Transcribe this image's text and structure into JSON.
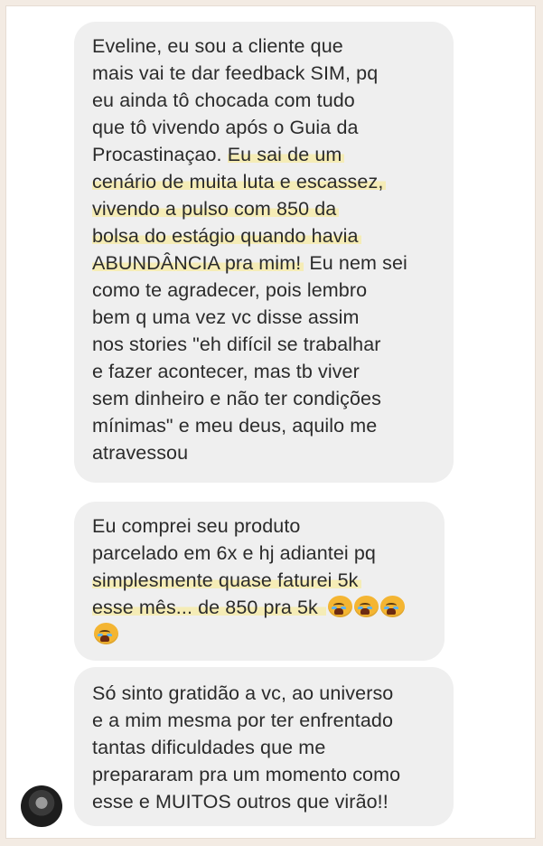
{
  "messages": [
    {
      "lines": [
        [
          {
            "t": "Eveline, eu sou a cliente que"
          }
        ],
        [
          {
            "t": "mais vai te dar feedback SIM, pq"
          }
        ],
        [
          {
            "t": "eu ainda tô chocada com tudo"
          }
        ],
        [
          {
            "t": "que tô vivendo após o Guia da"
          }
        ],
        [
          {
            "t": "Procastinaçao. "
          },
          {
            "t": "Eu sai de um",
            "hl": true
          }
        ],
        [
          {
            "t": "cenário de muita luta e escassez,",
            "hl": true
          }
        ],
        [
          {
            "t": "vivendo a pulso com 850 da",
            "hl": true
          }
        ],
        [
          {
            "t": "bolsa do estágio quando havia",
            "hl": true
          }
        ],
        [
          {
            "t": "ABUNDÂNCIA pra mim!",
            "hl": true
          },
          {
            "t": " Eu nem sei"
          }
        ],
        [
          {
            "t": "como te agradecer, pois lembro"
          }
        ],
        [
          {
            "t": "bem q uma vez vc disse assim"
          }
        ],
        [
          {
            "t": "nos stories \"eh difícil se trabalhar"
          }
        ],
        [
          {
            "t": "e fazer acontecer, mas tb viver"
          }
        ],
        [
          {
            "t": "sem dinheiro e não ter condições"
          }
        ],
        [
          {
            "t": "mínimas\" e meu deus, aquilo me"
          }
        ],
        [
          {
            "t": "atravessou"
          }
        ]
      ]
    },
    {
      "lines": [
        [
          {
            "t": "Eu comprei seu produto"
          }
        ],
        [
          {
            "t": "parcelado em 6x e hj adiantei pq"
          }
        ],
        [
          {
            "t": "simplesmente quase faturei 5k",
            "hl": true
          }
        ],
        [
          {
            "t": "esse mês... de 850 pra 5k ",
            "hl": true
          },
          {
            "emoji": "crying-face",
            "hl": true
          },
          {
            "emoji": "crying-face",
            "hl": true
          },
          {
            "emoji": "crying-face",
            "hl": true
          }
        ],
        [
          {
            "emoji": "crying-face",
            "hl": true
          }
        ]
      ]
    },
    {
      "lines": [
        [
          {
            "t": "Só sinto gratidão a vc, ao universo"
          }
        ],
        [
          {
            "t": "e a mim mesma por ter enfrentado"
          }
        ],
        [
          {
            "t": "tantas dificuldades que me"
          }
        ],
        [
          {
            "t": "prepararam pra um momento como"
          }
        ],
        [
          {
            "t": "esse e MUITOS outros que virão!!"
          }
        ]
      ]
    }
  ],
  "colors": {
    "highlight": "#f5ecb6",
    "bubble": "#efefef",
    "text": "#2b2b2b"
  }
}
